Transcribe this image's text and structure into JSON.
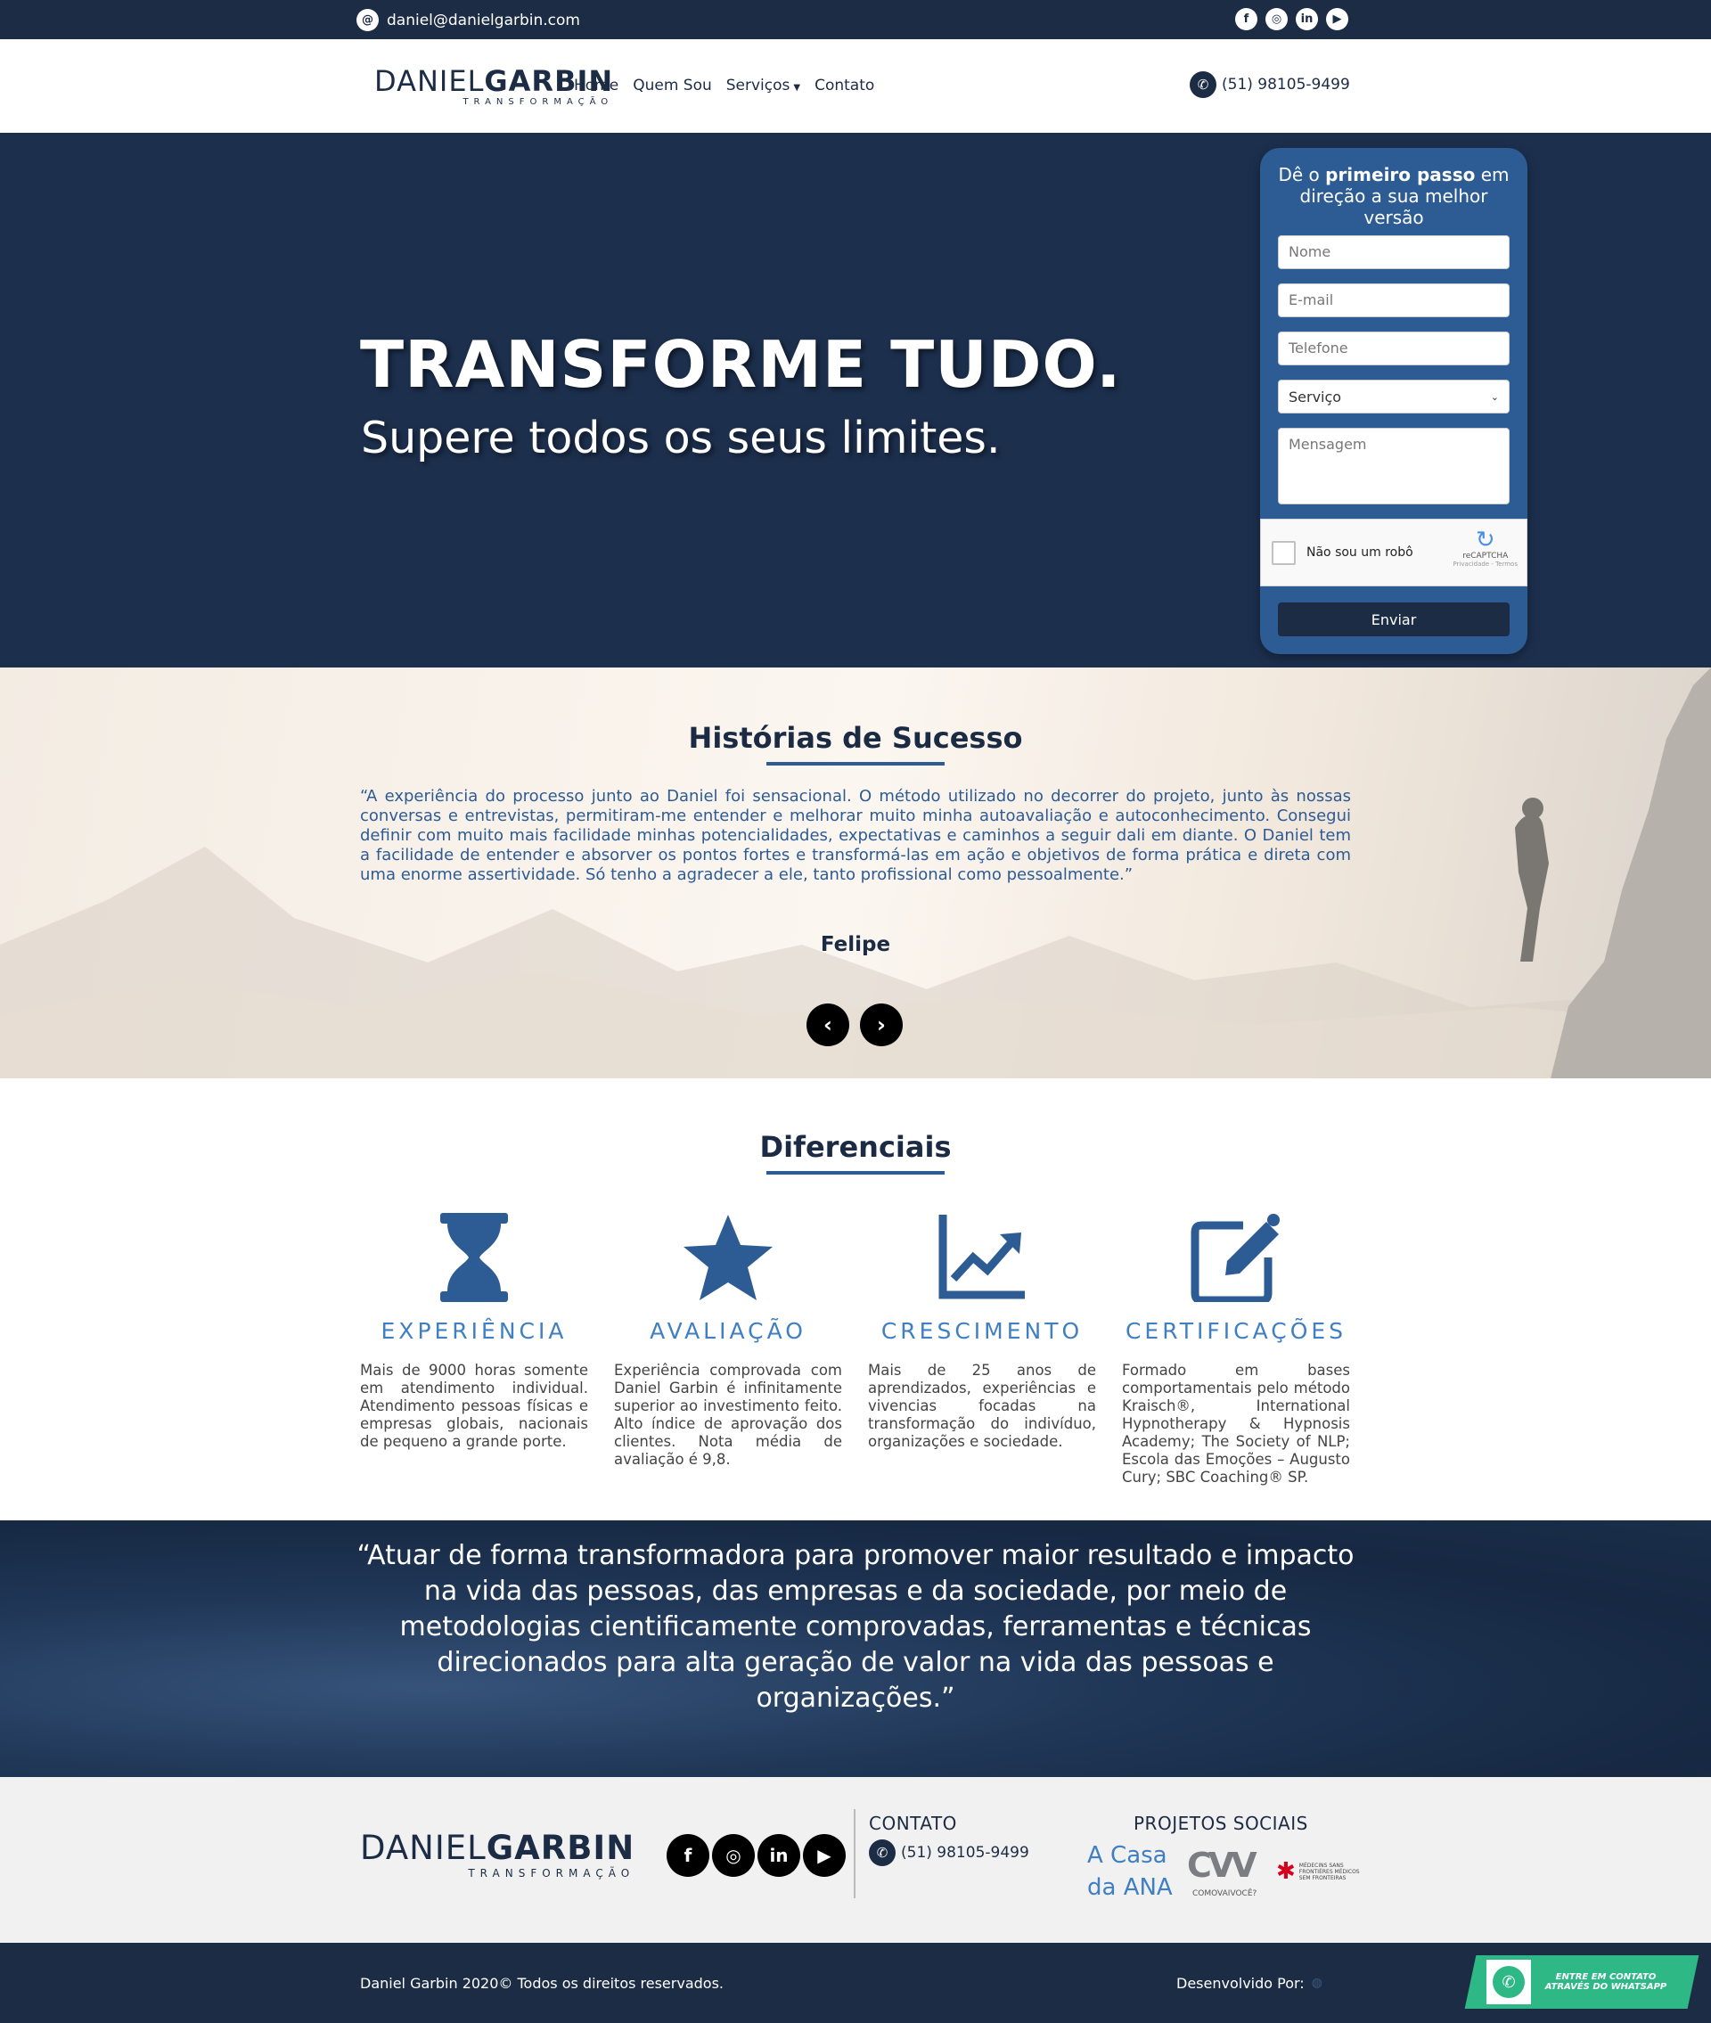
{
  "topbar": {
    "email": "daniel@danielgarbin.com",
    "social_icons": [
      "facebook-icon",
      "instagram-icon",
      "linkedin-icon",
      "youtube-icon"
    ]
  },
  "brand": {
    "name_thin": "DANIEL",
    "name_bold": "GARBIN",
    "tagline": "TRANSFORMAÇÃO"
  },
  "nav": {
    "items": [
      "Home",
      "Quem Sou",
      "Serviços",
      "Contato"
    ],
    "phone": "(51) 98105-9499"
  },
  "hero": {
    "title": "TRANSFORME TUDO.",
    "subtitle": "Supere todos os seus limites."
  },
  "form": {
    "title_pre": "Dê o ",
    "title_bold": "primeiro passo",
    "title_post": " em direção a sua melhor versão",
    "name_placeholder": "Nome",
    "email_placeholder": "E-mail",
    "phone_placeholder": "Telefone",
    "service_selected": "Serviço",
    "message_placeholder": "Mensagem",
    "captcha_label": "Não sou um robô",
    "captcha_brand": "reCAPTCHA",
    "captcha_links": "Privacidade - Termos",
    "submit_label": "Enviar"
  },
  "testimonials": {
    "title": "Histórias de Sucesso",
    "quote": "“A experiência do processo junto ao Daniel foi sensacional. O método utilizado no decorrer do projeto, junto às nossas conversas e entrevistas, permitiram-me entender e melhorar muito minha autoavaliação e autoconhecimento. Consegui definir com muito mais facilidade minhas potencialidades, expectativas e caminhos a seguir dali em diante. O Daniel tem a facilidade de entender e absorver os pontos fortes e transformá-las em ação e objetivos de forma prática e direta com uma enorme assertividade. Só tenho a agradecer a ele, tanto profissional como pessoalmente.”",
    "author": "Felipe"
  },
  "differentials": {
    "title": "Diferenciais",
    "items": [
      {
        "icon": "hourglass-icon",
        "name": "EXPERIÊNCIA",
        "text": "Mais de 9000 horas somente em atendimento individual. Atendimento pessoas físicas e empresas globais, nacionais de pequeno a grande porte."
      },
      {
        "icon": "star-icon",
        "name": "AVALIAÇÃO",
        "text": "Experiência comprovada com Daniel Garbin é infinitamente superior ao investimento feito. Alto índice de aprovação dos clientes. Nota média de avaliação é 9,8."
      },
      {
        "icon": "chart-line-icon",
        "name": "CRESCIMENTO",
        "text": "Mais de 25 anos de aprendizados, experiências e vivencias focadas na transformação do indivíduo, organizações e sociedade."
      },
      {
        "icon": "edit-icon",
        "name": "CERTIFICAÇÕES",
        "text": "Formado em bases comportamentais pelo método Kraisch®, International Hypnotherapy & Hypnosis Academy; The Society of NLP; Escola das Emoções – Augusto Cury; SBC Coaching® SP."
      }
    ]
  },
  "mission": {
    "text": "“Atuar de forma transformadora para promover maior resultado e impacto na vida das pessoas, das empresas e da sociedade, por meio de metodologias cientificamente comprovadas, ferramentas e técnicas direcionados para alta geração de valor na vida das pessoas e organizações.”"
  },
  "footer": {
    "contact_title": "CONTATO",
    "contact_phone": "(51) 98105-9499",
    "projects_title": "PROJETOS SOCIAIS",
    "project_acasa": "A Casa da ANA",
    "project_cvv": "CVV",
    "project_cvv_sub": "COMOVAIVOCÊ?",
    "project_msf": "MÉDECINS SANS FRONTIÈRES MÉDICOS SEM FRONTEIRAS"
  },
  "bottom": {
    "copyright": "Daniel Garbin 2020© Todos os direitos reservados.",
    "developed_by": "Desenvolvido Por:",
    "whatsapp_cta": "ENTRE EM CONTATO ATRAVÉS DO WHATSAPP"
  },
  "colors": {
    "navy": "#1c2c45",
    "hero_bg": "#1c2f4d",
    "accent_blue": "#2d5b94",
    "light_blue": "#3f7fc2",
    "whatsapp_green": "#2eb886"
  }
}
